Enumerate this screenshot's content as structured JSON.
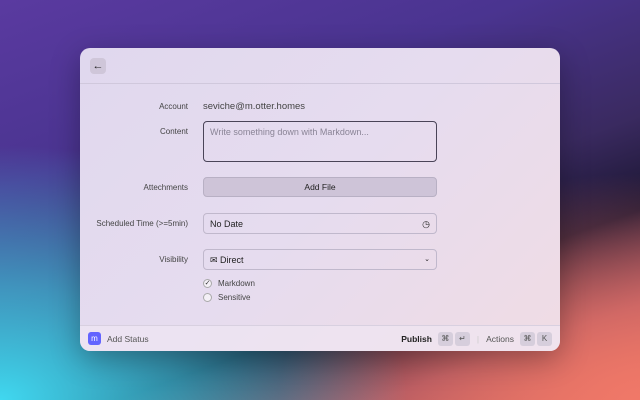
{
  "form": {
    "account_label": "Account",
    "account_value": "seviche@m.otter.homes",
    "content_label": "Content",
    "content_placeholder": "Write something down with Markdown...",
    "attachments_label": "Attechments",
    "add_file": "Add File",
    "scheduled_label": "Scheduled Time (>=5min)",
    "scheduled_value": "No Date",
    "visibility_label": "Visibility",
    "visibility_value": "Direct",
    "markdown": "Markdown",
    "markdown_checked": true,
    "sensitive": "Sensitive",
    "sensitive_checked": false
  },
  "footer": {
    "title": "Add Status",
    "publish": "Publish",
    "publish_keys": [
      "⌘",
      "↵"
    ],
    "actions": "Actions",
    "actions_keys": [
      "⌘",
      "K"
    ]
  }
}
